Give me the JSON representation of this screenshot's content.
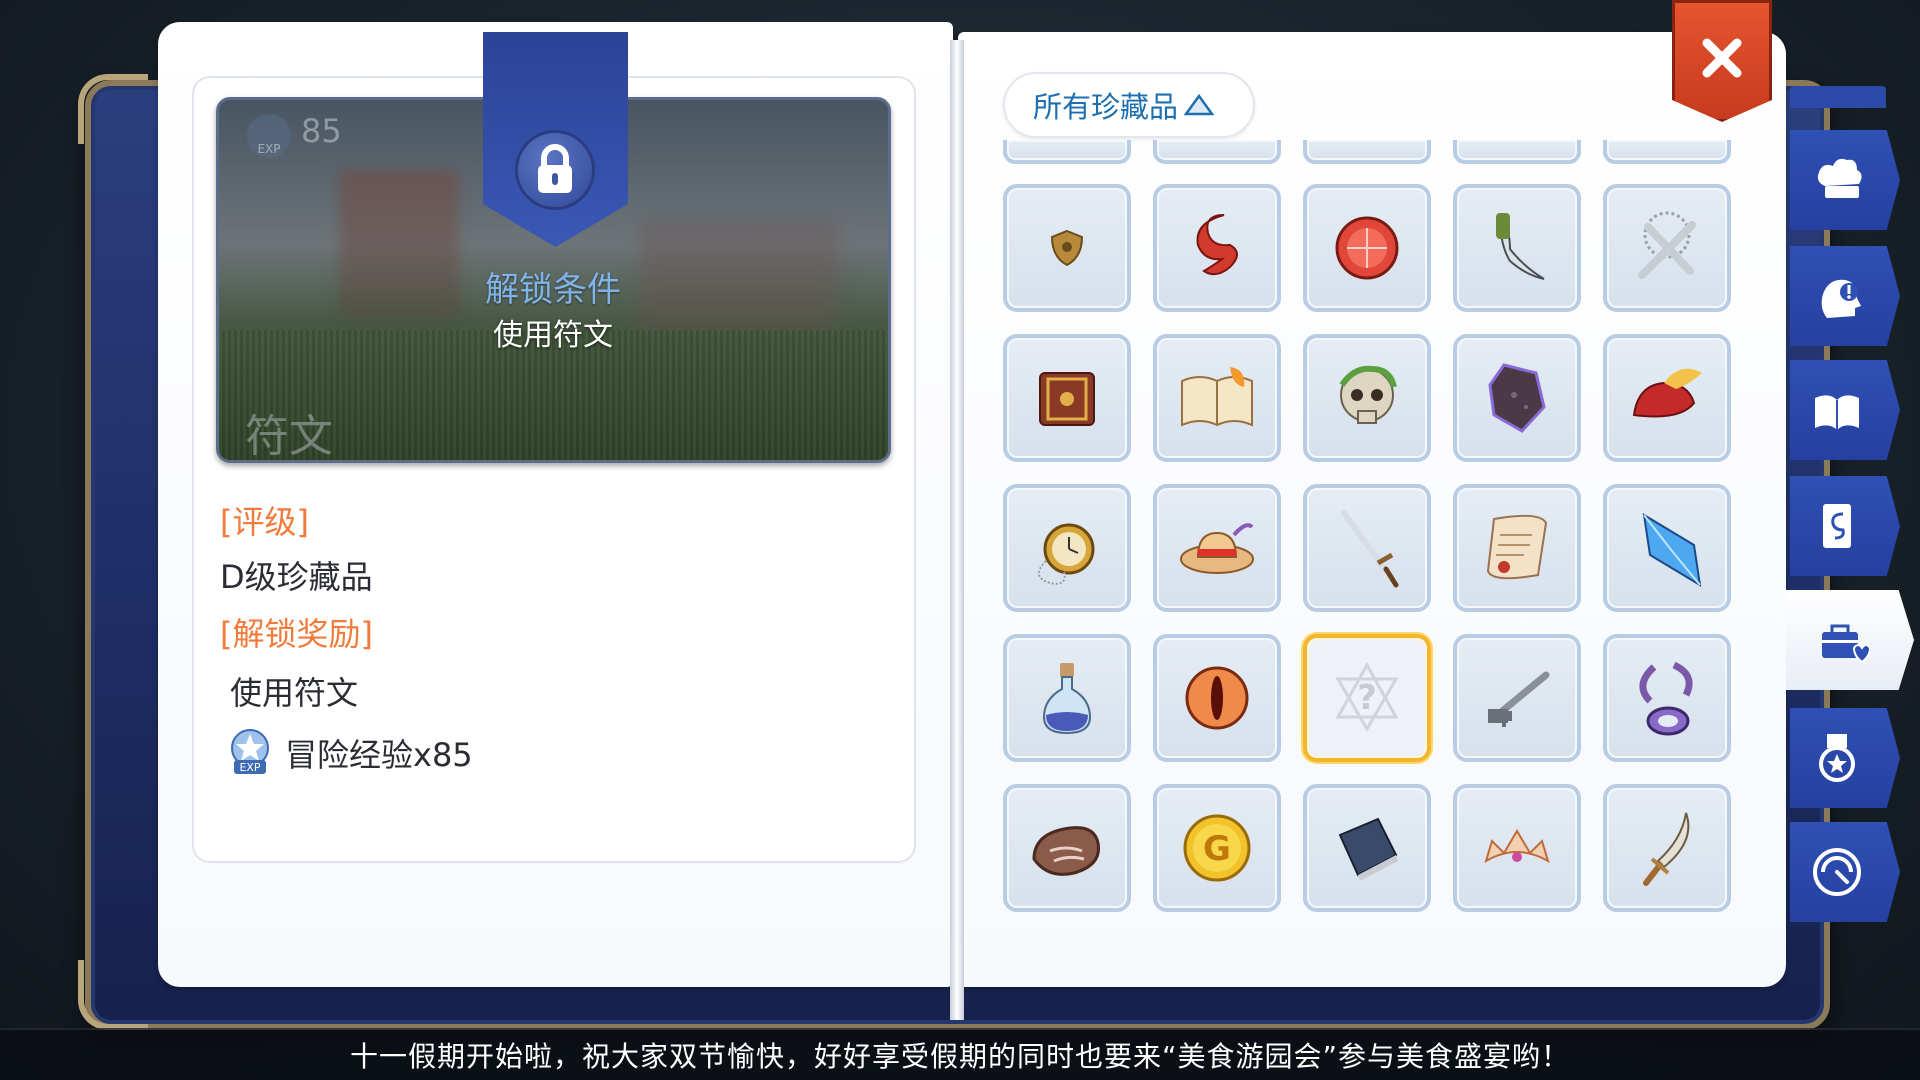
{
  "detail": {
    "exp_value": "85",
    "exp_badge_text": "EXP",
    "preview_name": "符文",
    "unlock_title": "解锁条件",
    "unlock_condition": "使用符文",
    "grade_label": "[评级]",
    "grade_value": "D级珍藏品",
    "reward_label": "[解锁奖励]",
    "reward_condition": "使用符文",
    "reward_exp": "冒险经验x85"
  },
  "filter": {
    "label": "所有珍藏品"
  },
  "collection": {
    "items": [
      {
        "icon": "shield-emblem-icon"
      },
      {
        "icon": "red-scarf-icon"
      },
      {
        "icon": "red-orb-icon"
      },
      {
        "icon": "curved-dagger-icon"
      },
      {
        "icon": "rosary-cross-icon"
      },
      {
        "icon": "ornate-tome-icon"
      },
      {
        "icon": "open-book-leaf-icon"
      },
      {
        "icon": "mossy-skull-icon"
      },
      {
        "icon": "dark-stone-icon"
      },
      {
        "icon": "feathered-cap-icon"
      },
      {
        "icon": "pocket-watch-icon"
      },
      {
        "icon": "straw-hat-icon"
      },
      {
        "icon": "longsword-icon"
      },
      {
        "icon": "scroll-icon"
      },
      {
        "icon": "blue-crystal-icon"
      },
      {
        "icon": "potion-bottle-icon"
      },
      {
        "icon": "dragon-eye-orb-icon"
      },
      {
        "icon": "unknown-item-icon",
        "selected": true
      },
      {
        "icon": "old-key-icon"
      },
      {
        "icon": "chain-ring-icon"
      },
      {
        "icon": "meat-steak-icon"
      },
      {
        "icon": "gold-coin-icon"
      },
      {
        "icon": "dark-book-icon"
      },
      {
        "icon": "tiara-icon"
      },
      {
        "icon": "scimitar-icon"
      }
    ]
  },
  "side_tabs": [
    {
      "icon": "chef-hat-icon"
    },
    {
      "icon": "head-alert-icon"
    },
    {
      "icon": "open-book-icon"
    },
    {
      "icon": "card-icon"
    },
    {
      "icon": "briefcase-heart-icon",
      "active": true
    },
    {
      "icon": "medal-icon"
    },
    {
      "icon": "gauge-icon"
    }
  ],
  "marquee": {
    "text": "十一假期开始啦，祝大家双节愉快，好好享受假期的同时也要来“美食游园会”参与美食盛宴哟！"
  },
  "colors": {
    "accent_orange": "#f07b3a",
    "accent_blue": "#1e6fb0",
    "unlock_title": "#7fb4e8",
    "book_blue": "#2b3f7e",
    "selected_gold": "#f3b530",
    "close_red": "#e5552f"
  }
}
